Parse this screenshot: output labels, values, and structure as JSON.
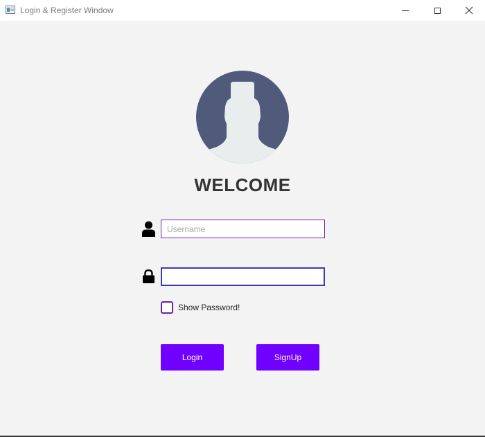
{
  "window": {
    "title": "Login & Register Window",
    "controls": [
      "minimize",
      "maximize",
      "close"
    ]
  },
  "avatar": {
    "icon": "user-avatar-icon",
    "bg_color": "#505a7a",
    "figure_color": "#e8edee"
  },
  "heading": "WELCOME",
  "username": {
    "value": "",
    "placeholder": "Username",
    "icon": "user-icon"
  },
  "password": {
    "value": "",
    "placeholder": "",
    "icon": "lock-icon"
  },
  "show_password": {
    "label": "Show Password!",
    "checked": false
  },
  "buttons": {
    "login": "Login",
    "signup": "SignUp"
  },
  "colors": {
    "accent": "#7000ff",
    "background": "#f3f3f3"
  }
}
